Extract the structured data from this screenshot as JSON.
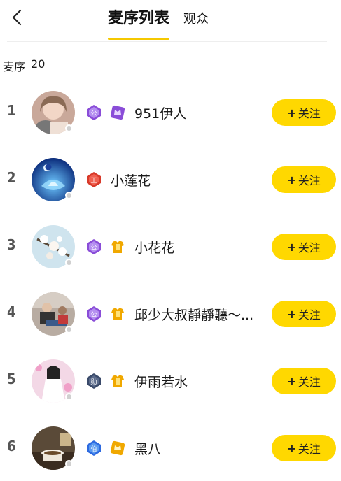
{
  "header": {
    "tabs": [
      {
        "label": "麦序列表",
        "active": true
      },
      {
        "label": "观众",
        "active": false
      }
    ]
  },
  "queue": {
    "label": "麦序",
    "count": "20"
  },
  "follow_label": "关注",
  "follow_plus": "+",
  "colors": {
    "accent_yellow": "#ffd800",
    "tab_underline": "#f5c800",
    "badge_purple": "#8a4dd8",
    "badge_red": "#d83a2a",
    "badge_gold": "#f0a800",
    "badge_navy": "#3a4a6a",
    "badge_blue": "#2d6ae0"
  },
  "users": [
    {
      "rank": "1",
      "name": "951伊人",
      "badges": [
        "gong-purple-badge",
        "crown-purple-badge"
      ]
    },
    {
      "rank": "2",
      "name": "小莲花",
      "badges": [
        "wang-red-badge"
      ]
    },
    {
      "rank": "3",
      "name": "小花花",
      "badges": [
        "gong-purple-badge",
        "shirt-gold-badge"
      ]
    },
    {
      "rank": "4",
      "name": "邱少大叔靜靜聽～...",
      "badges": [
        "gong-purple-badge",
        "shirt-gold-badge"
      ]
    },
    {
      "rank": "5",
      "name": "伊雨若水",
      "badges": [
        "xun-navy-badge",
        "shirt-gold-badge"
      ]
    },
    {
      "rank": "6",
      "name": "黑八",
      "badges": [
        "bo-blue-badge",
        "crown-gold-badge"
      ]
    }
  ]
}
